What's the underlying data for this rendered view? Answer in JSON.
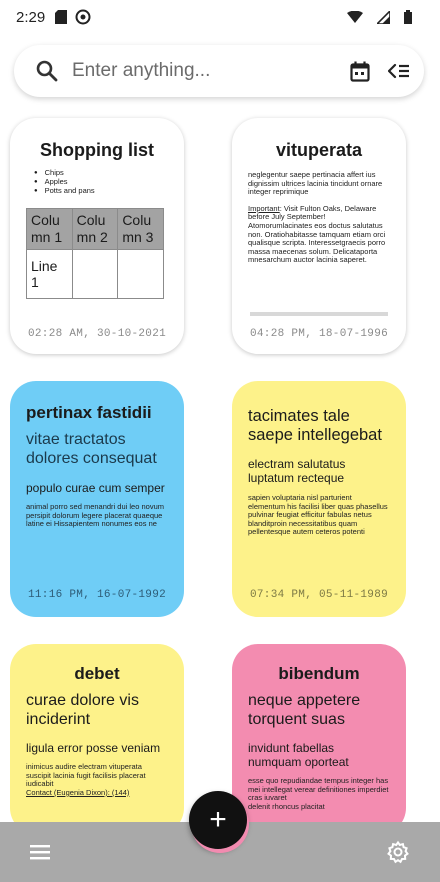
{
  "status_bar": {
    "time": "2:29",
    "icons": [
      "sd-card-icon",
      "no-disturb-icon",
      "wifi-icon",
      "signal-icon",
      "battery-icon"
    ]
  },
  "search": {
    "placeholder": "Enter anything...",
    "icons": [
      "search-icon",
      "calendar-icon",
      "filter-icon"
    ]
  },
  "notes": [
    {
      "style": "white",
      "title": "Shopping list",
      "bullets": [
        "Chips",
        "Apples",
        "Potts and pans"
      ],
      "table": {
        "headers": [
          "Colu mn 1",
          "Colu mn 2",
          "Colu mn 3"
        ],
        "rows": [
          [
            "Line 1",
            "",
            ""
          ]
        ]
      },
      "date": "02:28 AM, 30-10-2021"
    },
    {
      "style": "white",
      "title": "vituperata",
      "body1": "neglegentur saepe pertinacia affert ius dignissim ultrices lacinia tincidunt ornare integer reprimique",
      "body2_underlined": "Important",
      "body2": ": Visit Fulton Oaks, Delaware before July September! Atomorumlacinates eos doctus salutatus non. Oratiohabitasse tamquam etiam orci qualisque scripta. Interessetgraecis porro massa maecenas solum. Delicataporta mnesarchum auctor lacinia saperet.",
      "date": "04:28 PM, 18-07-1996"
    },
    {
      "style": "blue",
      "title": "pertinax fastidii",
      "subtitle": "vitae tractatos dolores consequat",
      "heading": "populo curae cum semper",
      "body": "animal porro sed menandri dui leo novum persipit dolorum legere placerat quaeque latine ei Hissapientem nonumes eos ne",
      "date": "11:16 PM, 16-07-1992"
    },
    {
      "style": "yellow",
      "title": "tacimates tale saepe intellegebat",
      "subtitle": "electram salutatus luptatum recteque",
      "body": "sapien voluptaria nisl parturient elementum his facilisi liber quas phasellus pulvinar feugiat efficitur fabulas netus blanditproin necessitatibus quam pellentesque autem ceteros potenti",
      "date": "07:34 PM, 05-11-1989"
    },
    {
      "style": "yellow",
      "title": "debet",
      "subtitle": "curae dolore vis inciderint",
      "heading": "ligula error posse veniam",
      "body": "inimicus audire electram vituperata suscipit lacinia fugit facilisis placerat iudicabit",
      "body_extra": "Contact (Eugenia Dixon): (144)",
      "date": ""
    },
    {
      "style": "pink",
      "title": "bibendum",
      "subtitle": "neque appetere torquent suas",
      "heading": "invidunt fabellas numquam oporteat",
      "body": "esse quo repudiandae tempus integer has mei intellegat verear definitiones imperdiet cras iuvaret",
      "body_extra": "delenit rhoncus placitat",
      "date": ""
    }
  ],
  "fab": {
    "label": "+"
  },
  "bottom_bar": {
    "icons": [
      "menu-icon",
      "settings-icon"
    ]
  }
}
